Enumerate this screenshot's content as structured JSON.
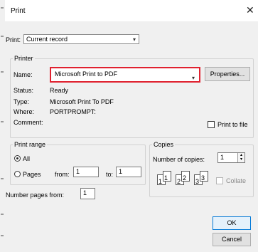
{
  "dialog": {
    "title": "Print",
    "close_glyph": "✕"
  },
  "print_what": {
    "label": "Print:",
    "value": "Current record"
  },
  "printer": {
    "group_label": "Printer",
    "name_label": "Name:",
    "name_value": "Microsoft Print to PDF",
    "properties_label": "Properties...",
    "status_label": "Status:",
    "status_value": "Ready",
    "type_label": "Type:",
    "type_value": "Microsoft Print To PDF",
    "where_label": "Where:",
    "where_value": "PORTPROMPT:",
    "comment_label": "Comment:",
    "print_to_file_label": "Print to file"
  },
  "print_range": {
    "group_label": "Print range",
    "all_label": "All",
    "pages_label": "Pages",
    "from_label": "from:",
    "from_value": "1",
    "to_label": "to:",
    "to_value": "1"
  },
  "copies": {
    "group_label": "Copies",
    "number_label": "Number of copies:",
    "number_value": "1",
    "collate_label": "Collate",
    "collate_pages": [
      "1",
      "1",
      "2",
      "2",
      "3",
      "3"
    ]
  },
  "number_pages": {
    "label": "Number pages from:",
    "value": "1"
  },
  "buttons": {
    "ok": "OK",
    "cancel": "Cancel"
  },
  "colors": {
    "highlight": "#e0212f",
    "ok_border": "#0078d7"
  }
}
